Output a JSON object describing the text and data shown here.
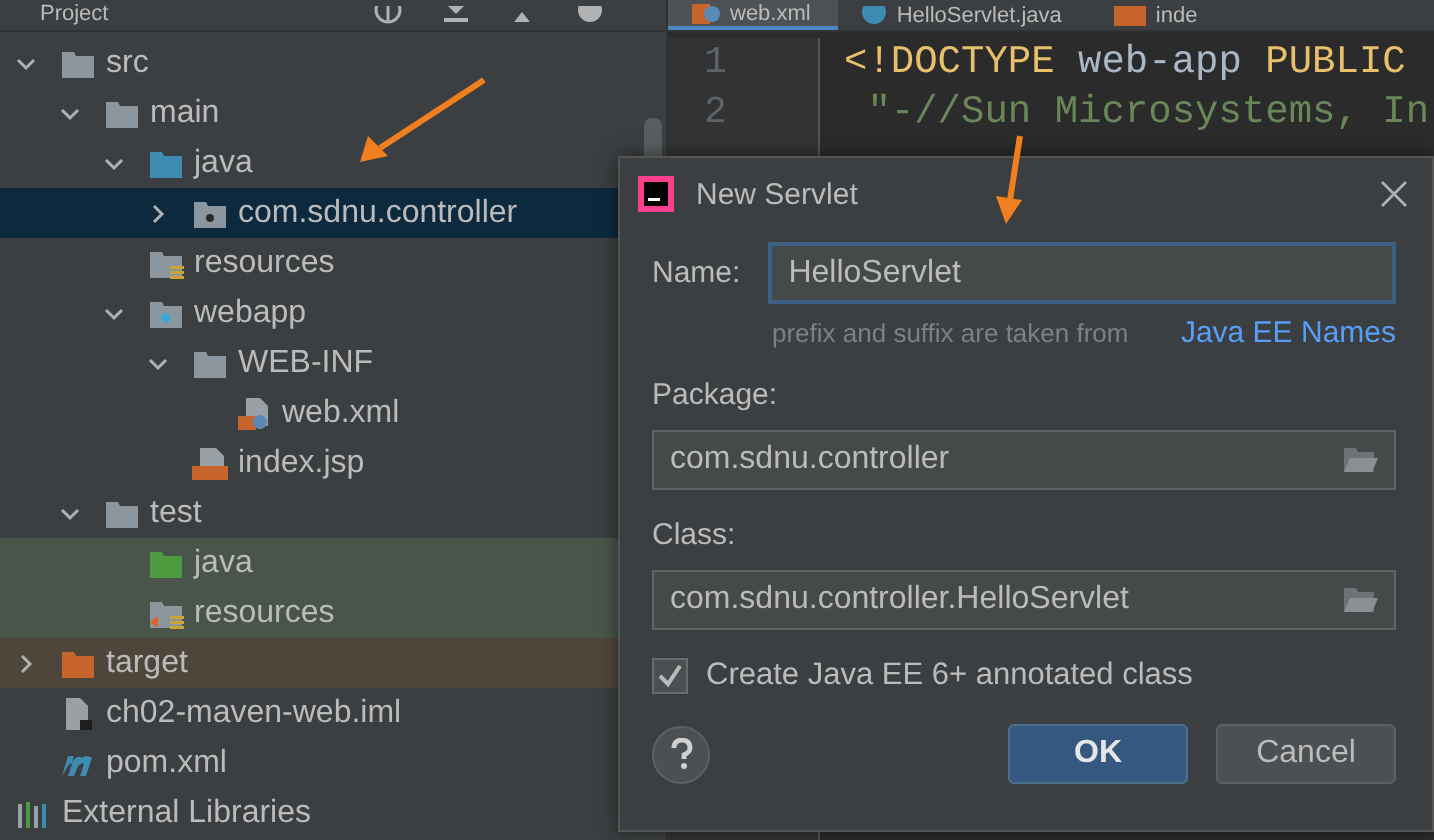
{
  "project_panel": {
    "title": "Project",
    "tree": [
      {
        "label": "src",
        "kind": "folder",
        "expanded": true,
        "selected": false,
        "children": [
          {
            "label": "main",
            "kind": "folder",
            "expanded": true,
            "selected": false,
            "children": [
              {
                "label": "java",
                "kind": "source-folder",
                "expanded": true,
                "selected": false,
                "children": [
                  {
                    "label": "com.sdnu.controller",
                    "kind": "package",
                    "expanded": false,
                    "selected": true
                  }
                ]
              },
              {
                "label": "resources",
                "kind": "resources-folder",
                "selected": false
              },
              {
                "label": "webapp",
                "kind": "web-folder",
                "expanded": true,
                "selected": false,
                "children": [
                  {
                    "label": "WEB-INF",
                    "kind": "folder",
                    "expanded": true,
                    "selected": false,
                    "children": [
                      {
                        "label": "web.xml",
                        "kind": "xml-file",
                        "selected": false
                      }
                    ]
                  },
                  {
                    "label": "index.jsp",
                    "kind": "jsp-file",
                    "selected": false
                  }
                ]
              }
            ]
          },
          {
            "label": "test",
            "kind": "folder",
            "expanded": true,
            "selected": false,
            "children": [
              {
                "label": "java",
                "kind": "test-source-folder",
                "selected": false
              },
              {
                "label": "resources",
                "kind": "test-resources-folder",
                "selected": false
              }
            ]
          }
        ]
      },
      {
        "label": "target",
        "kind": "excluded-folder",
        "expanded": false,
        "selected": false
      },
      {
        "label": "ch02-maven-web.iml",
        "kind": "iml-file",
        "selected": false
      },
      {
        "label": "pom.xml",
        "kind": "maven-file",
        "selected": false
      },
      {
        "label": "External Libraries",
        "kind": "libraries",
        "selected": false
      }
    ]
  },
  "editor": {
    "tabs": [
      {
        "label": "web.xml",
        "kind": "xml",
        "selected": true
      },
      {
        "label": "HelloServlet.java",
        "kind": "java",
        "selected": false
      },
      {
        "label": "inde",
        "kind": "jsp",
        "selected": false
      }
    ],
    "lines": [
      {
        "number": "1",
        "segments": [
          {
            "text": "<!DOCTYPE",
            "kind": "tag"
          },
          {
            "text": " web-app ",
            "kind": "plain"
          },
          {
            "text": "PUBLIC",
            "kind": "tag"
          }
        ]
      },
      {
        "number": "2",
        "segments": [
          {
            "text": " \"-//Sun Microsystems, In",
            "kind": "string"
          }
        ]
      }
    ]
  },
  "dialog": {
    "title": "New Servlet",
    "name": {
      "label": "Name:",
      "value": "HelloServlet"
    },
    "hint": "prefix and suffix are taken from",
    "hint_link": "Java EE Names",
    "package": {
      "label": "Package:",
      "value": "com.sdnu.controller"
    },
    "class": {
      "label": "Class:",
      "value": "com.sdnu.controller.HelloServlet"
    },
    "annotated": {
      "label": "Create Java EE 6+ annotated class",
      "checked": true
    },
    "buttons": [
      {
        "label": "OK",
        "default": true
      },
      {
        "label": "Cancel",
        "default": false
      }
    ]
  }
}
